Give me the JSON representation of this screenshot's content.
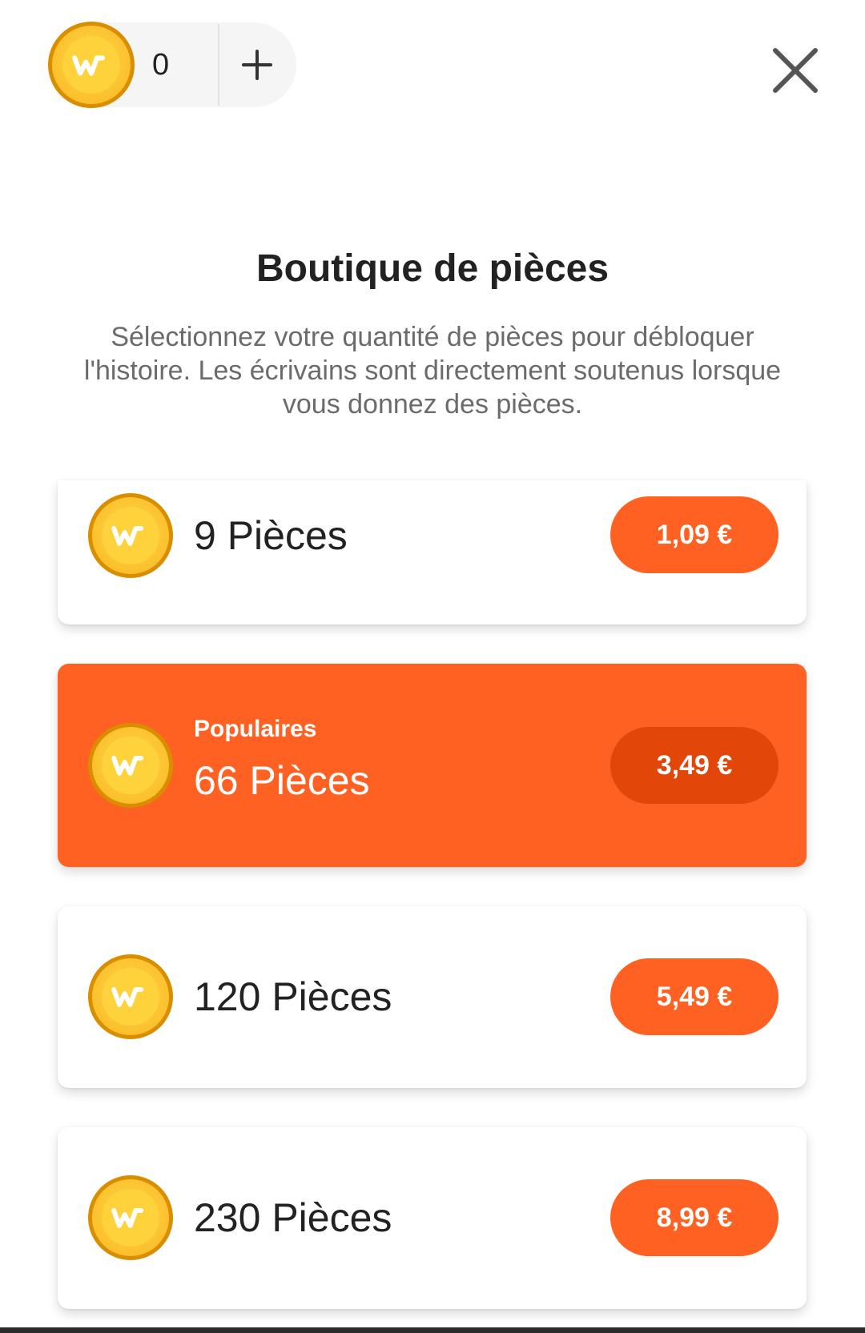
{
  "header": {
    "balance": "0",
    "coin_icon": "wattpad-coin-icon",
    "add_icon": "plus-icon",
    "close_icon": "close-icon"
  },
  "shop": {
    "title": "Boutique de pièces",
    "description": "Sélectionnez votre quantité de pièces pour débloquer l'histoire. Les écrivains sont directement soutenus lorsque vous donnez des pièces."
  },
  "packages": [
    {
      "label": "9 Pièces",
      "price": "1,09 €"
    },
    {
      "label": "66 Pièces",
      "price": "3,49 €",
      "tag": "Populaires"
    },
    {
      "label": "120 Pièces",
      "price": "5,49 €"
    },
    {
      "label": "230 Pièces",
      "price": "8,99 €"
    }
  ],
  "colors": {
    "accent": "#ff6122",
    "accent_dark": "#e24709",
    "coin": "#fbc02d"
  }
}
